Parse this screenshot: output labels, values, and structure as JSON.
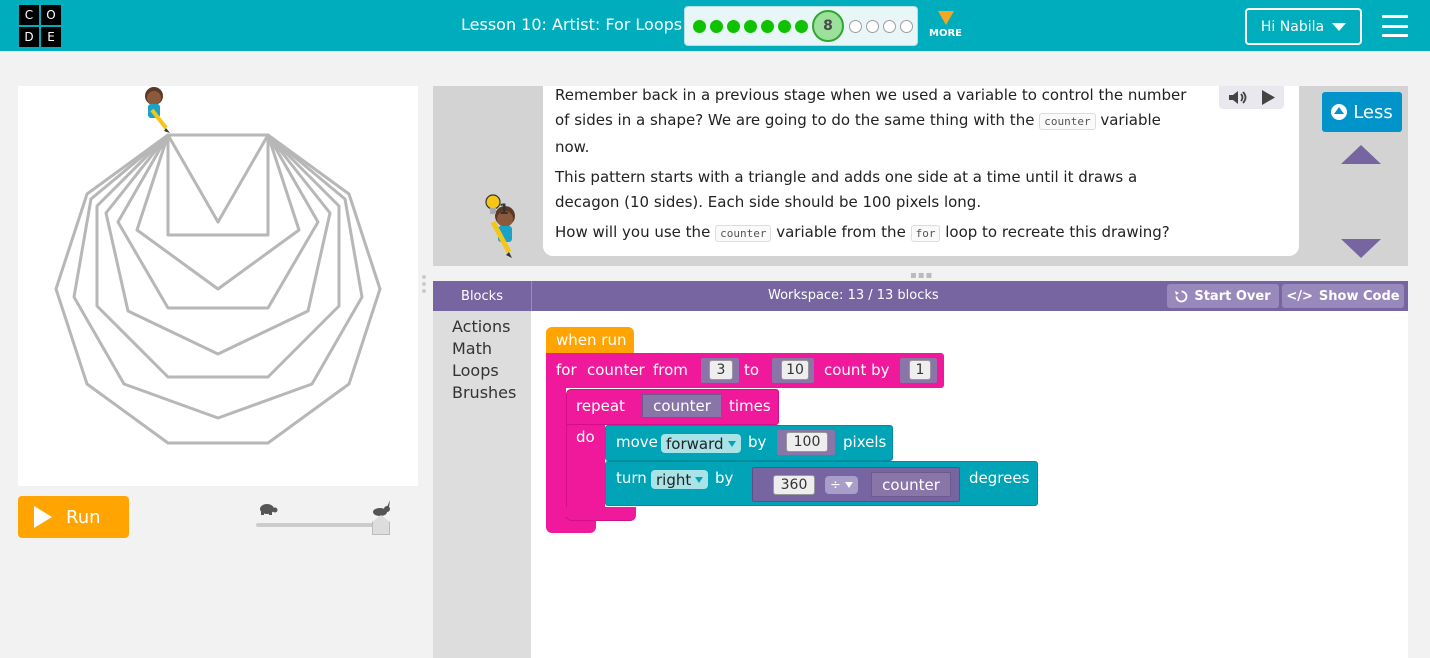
{
  "header": {
    "logo_letters": [
      "C",
      "O",
      "D",
      "E"
    ],
    "lesson_title": "Lesson 10: Artist: For Loops",
    "current_level": "8",
    "more_label": "MORE",
    "user_label": "Hi Nabila",
    "colors": {
      "bar": "#00adbc",
      "done": "#0ec200",
      "more": "#f5a623"
    }
  },
  "visualization": {
    "run_label": "Run",
    "speed_level": 1.0
  },
  "instructions": {
    "line1": "Remember back in a previous stage when we used a variable to control the number",
    "line2_pre": "of sides in a shape? We are going to do the same thing with the",
    "line2_code": "counter",
    "line2_post": "variable",
    "line3": "now.",
    "line4": "This pattern starts with a triangle and adds one side at a time until it draws a",
    "line5": "decagon (10 sides). Each side should be 100 pixels long.",
    "line6_pre": "How will you use the",
    "line6_code": "counter",
    "line6_mid": "variable from the",
    "line6_code2": "for",
    "line6_post": "loop to recreate this drawing?",
    "hint_count": "1",
    "less_label": "Less"
  },
  "workspace": {
    "toolbox_tab": "Blocks",
    "block_count": "Workspace: 13 / 13 blocks",
    "start_over": "Start Over",
    "show_code": "Show Code",
    "categories": [
      "Actions",
      "Math",
      "Loops",
      "Brushes"
    ],
    "blocks": {
      "when_run": "when run",
      "for_label": "for",
      "for_var": "counter",
      "from_label": "from",
      "from_val": "3",
      "to_label": "to",
      "to_val": "10",
      "by_label": "count by",
      "by_val": "1",
      "repeat_label": "repeat",
      "repeat_var": "counter",
      "times_label": "times",
      "do_label": "do",
      "move_label": "move",
      "move_dir": "forward",
      "move_by": "by",
      "move_val": "100",
      "pixels_label": "pixels",
      "turn_label": "turn",
      "turn_dir": "right",
      "turn_by": "by",
      "turn_num": "360",
      "turn_op": "÷",
      "turn_var": "counter",
      "degrees_label": "degrees"
    },
    "colors": {
      "loop": "#f0199b",
      "event": "#ffa400",
      "action": "#00a4b6",
      "math": "#7665a0"
    }
  }
}
